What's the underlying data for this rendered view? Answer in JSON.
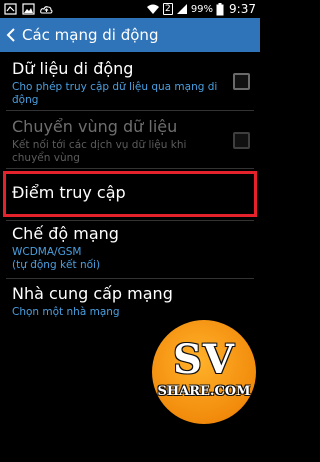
{
  "status_bar": {
    "sim_label": "2",
    "battery_text": "99%",
    "time": "9:37",
    "icons": [
      "notification-icon",
      "image-icon",
      "cloud-upload-icon",
      "wifi-icon",
      "signal-icon",
      "battery-icon"
    ]
  },
  "action_bar": {
    "back_icon": "chevron-left-icon",
    "title": "Các mạng di động",
    "color": "#2f73b9"
  },
  "items": [
    {
      "title": "Dữ liệu di động",
      "subtitle": "Cho phép truy cập dữ liệu qua mạng di động",
      "checked": false,
      "enabled": true
    },
    {
      "title": "Chuyển vùng dữ liệu",
      "subtitle": "Kết nối tới các dịch vụ dữ liệu khi chuyển vùng",
      "checked": false,
      "enabled": false
    },
    {
      "title": "Điểm truy cập",
      "enabled": true,
      "highlighted": true
    },
    {
      "title": "Chế độ mạng",
      "subtitle": "WCDMA/GSM",
      "subtitle2": "(tự động kết nối)",
      "enabled": true
    },
    {
      "title": "Nhà cung cấp mạng",
      "subtitle": "Chọn một nhà mạng",
      "enabled": true
    }
  ],
  "watermark": {
    "line1": "SV",
    "line2": "SHARE.COM"
  },
  "colors": {
    "highlight_border": "#e3222b",
    "subtitle_blue": "#4a9fe0"
  }
}
